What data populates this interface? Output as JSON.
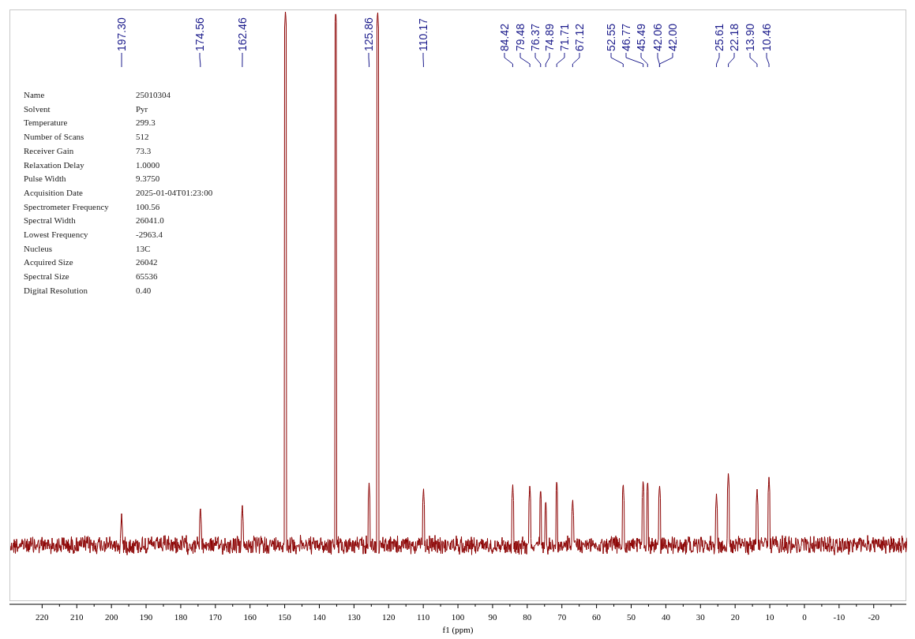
{
  "peak_labels": [
    "197.30",
    "174.56",
    "162.46",
    "125.86",
    "110.17",
    "84.42",
    "79.48",
    "76.37",
    "74.89",
    "71.71",
    "67.12",
    "52.55",
    "46.77",
    "45.49",
    "42.06",
    "42.00",
    "25.61",
    "22.18",
    "13.90",
    "10.46"
  ],
  "parameters": [
    {
      "name": "Name",
      "value": "25010304"
    },
    {
      "name": "Solvent",
      "value": "Pyr"
    },
    {
      "name": "Temperature",
      "value": "299.3"
    },
    {
      "name": "Number of Scans",
      "value": "512"
    },
    {
      "name": "Receiver Gain",
      "value": "73.3"
    },
    {
      "name": "Relaxation Delay",
      "value": "1.0000"
    },
    {
      "name": "Pulse Width",
      "value": "9.3750"
    },
    {
      "name": "Acquisition Date",
      "value": "2025-01-04T01:23:00"
    },
    {
      "name": "Spectrometer Frequency",
      "value": "100.56"
    },
    {
      "name": "Spectral Width",
      "value": "26041.0"
    },
    {
      "name": "Lowest Frequency",
      "value": "-2963.4"
    },
    {
      "name": "Nucleus",
      "value": "13C"
    },
    {
      "name": "Acquired Size",
      "value": "26042"
    },
    {
      "name": "Spectral Size",
      "value": "65536"
    },
    {
      "name": "Digital Resolution",
      "value": "0.40"
    }
  ],
  "x_axis": {
    "ticks": [
      "220",
      "210",
      "200",
      "190",
      "180",
      "170",
      "160",
      "150",
      "140",
      "130",
      "120",
      "110",
      "100",
      "90",
      "80",
      "70",
      "60",
      "50",
      "40",
      "30",
      "20",
      "10",
      "0",
      "-10",
      "-20"
    ],
    "label": "f1 (ppm)"
  }
}
